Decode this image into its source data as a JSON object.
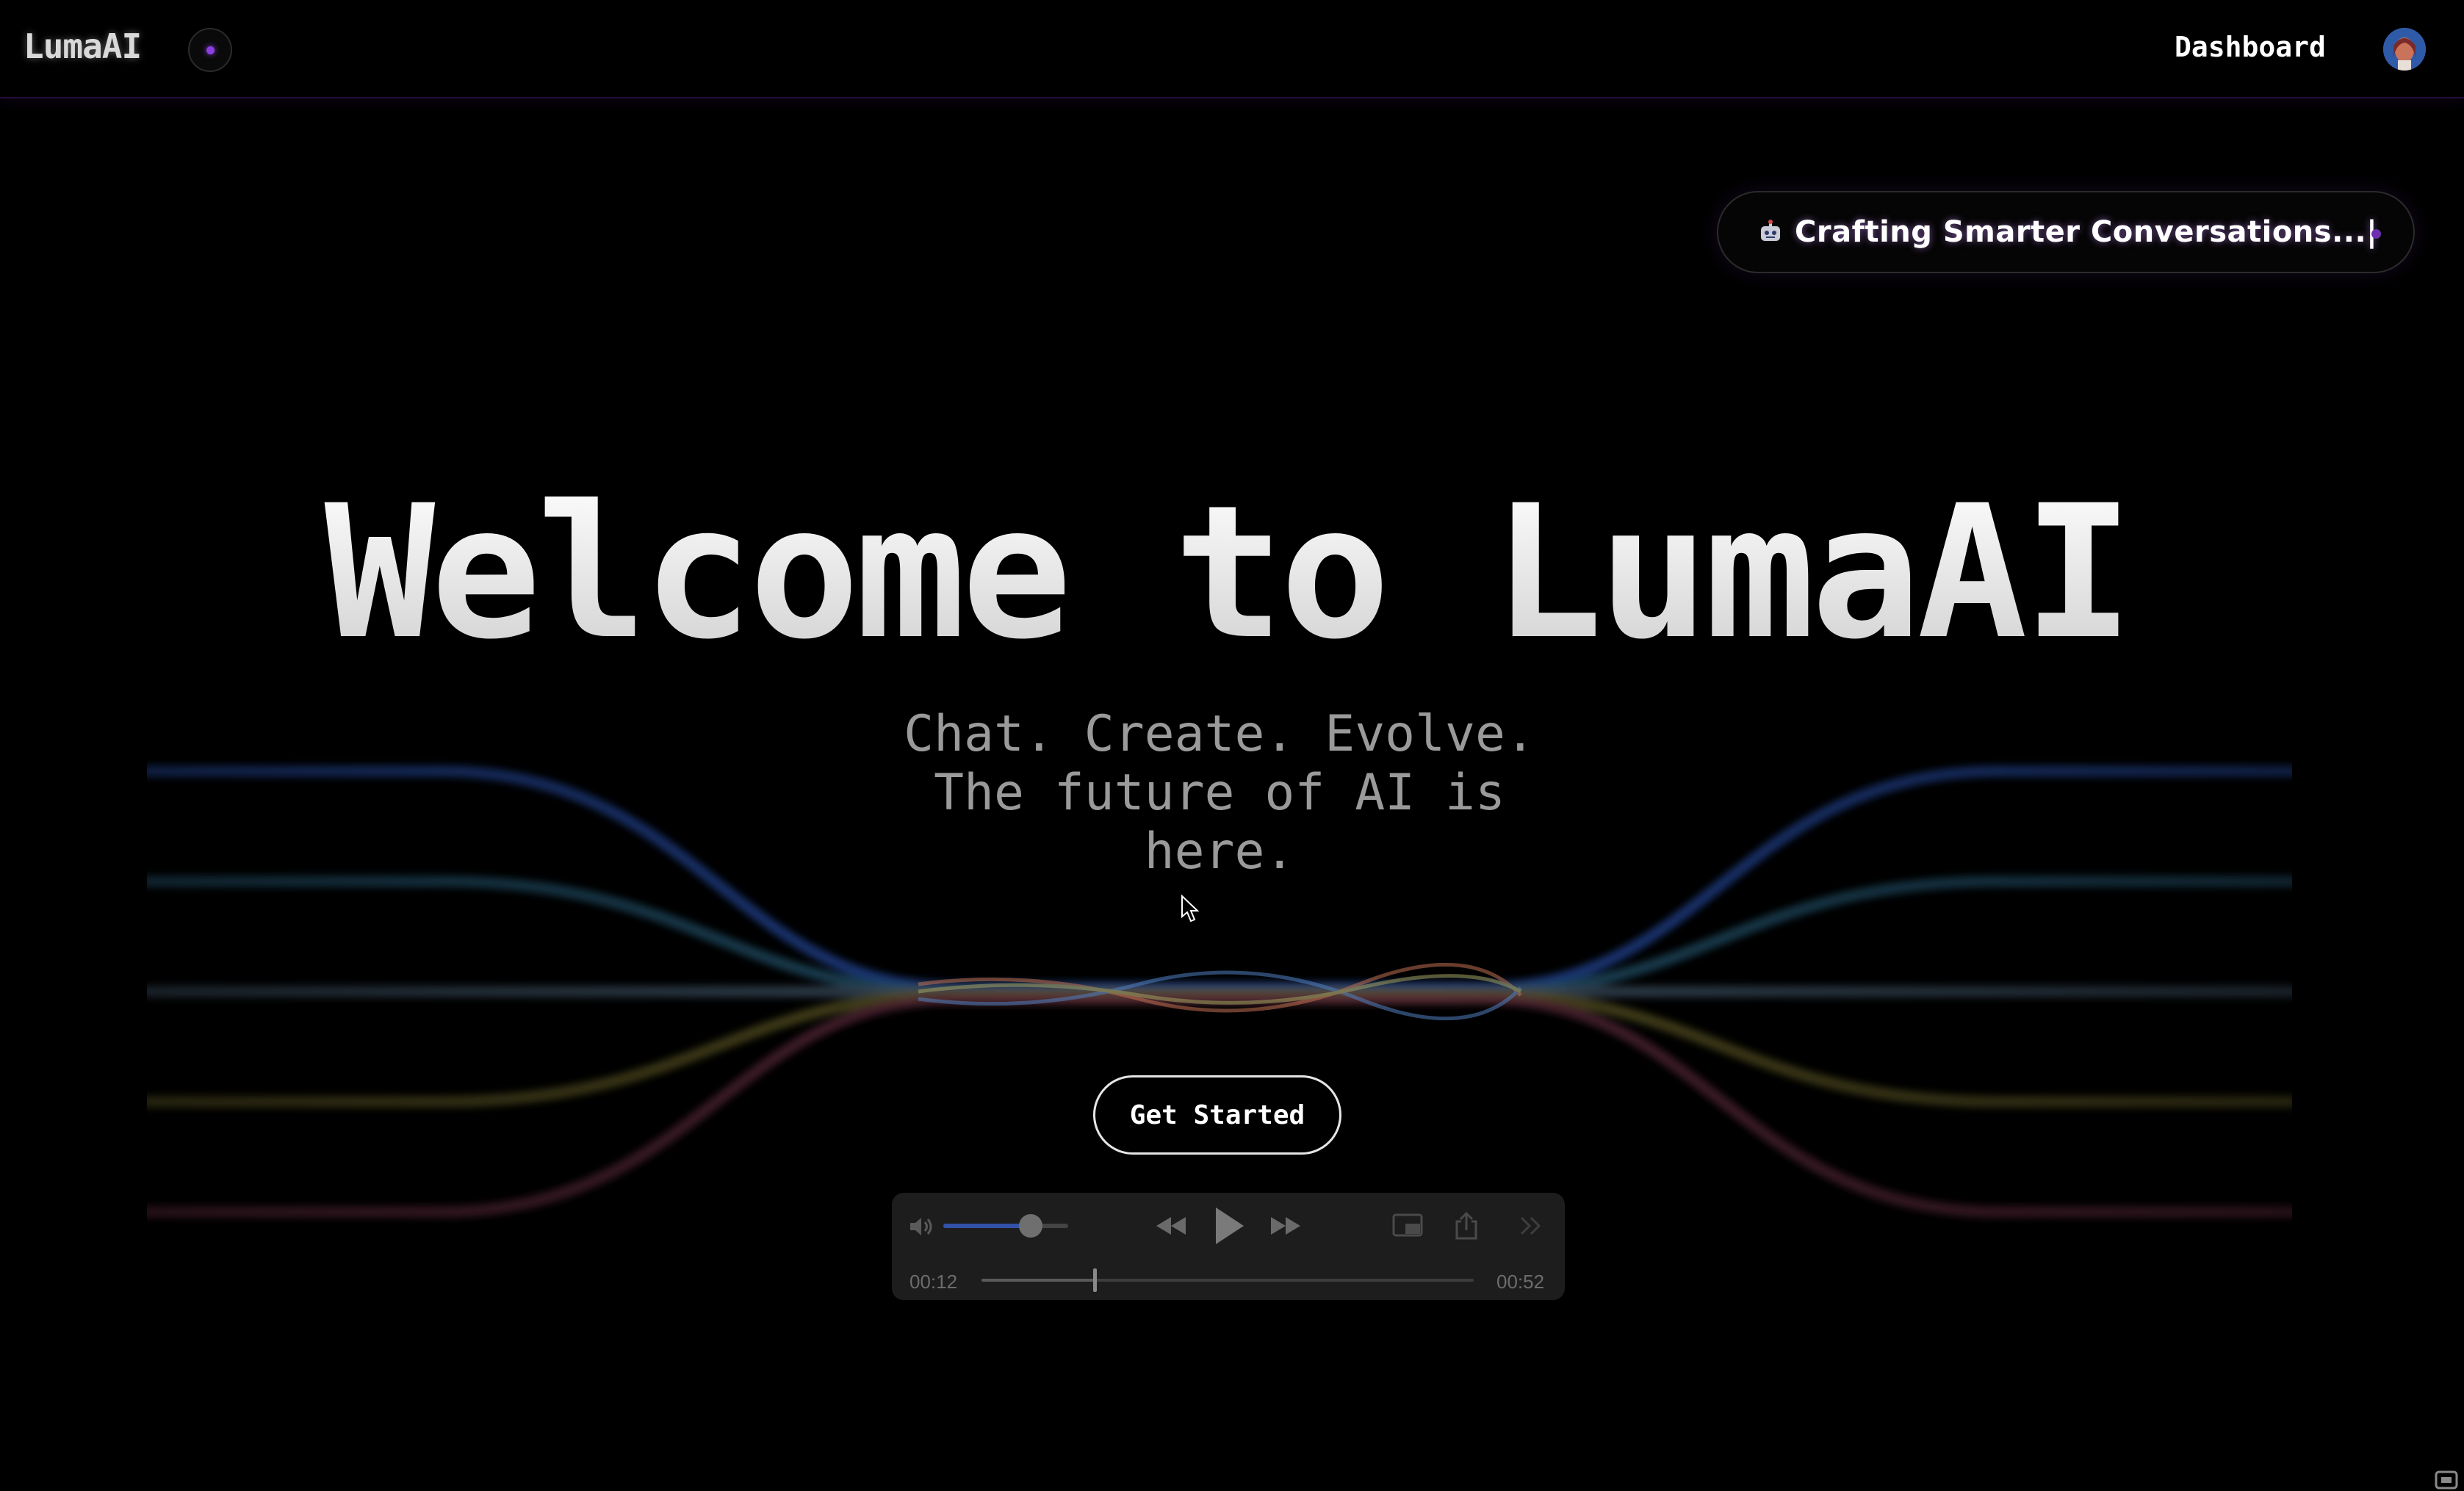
{
  "header": {
    "logo": "LumaAI",
    "nav_dashboard": "Dashboard"
  },
  "typing_banner": {
    "text": "Crafting Smarter Conversations...|"
  },
  "hero": {
    "title": "Welcome to LumaAI",
    "subtitle_line1": "Chat. Create. Evolve.",
    "subtitle_line2": "The future of AI is",
    "subtitle_line3": "here.",
    "cta_label": "Get Started"
  },
  "player": {
    "elapsed": "00:12",
    "duration": "00:52",
    "progress": 0.23,
    "volume": 0.7
  },
  "colors": {
    "background": "#000000",
    "accent_purple": "#8b3fe0",
    "wave_blue": "#1e3f8a",
    "wave_teal": "#1f5068",
    "wave_gray": "#3a4a5a",
    "wave_olive": "#5a5420",
    "wave_rose": "#5a2a3a"
  }
}
